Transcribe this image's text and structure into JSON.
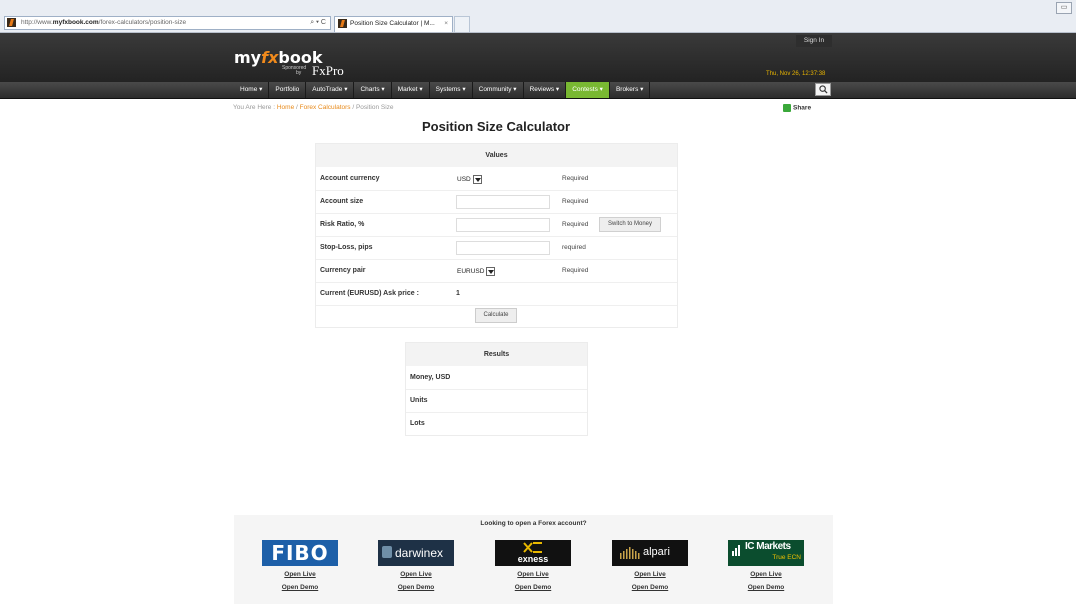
{
  "browser": {
    "url_prefix": "http://www.",
    "url_domain": "myfxbook.com",
    "url_path": "/forex-calculators/position-size",
    "url_tools": "⌕ ▾ C",
    "tab_title": "Position Size Calculator | M...",
    "tab_close": "×",
    "window_btn": "▭"
  },
  "header": {
    "logo_my": "my",
    "logo_fx": "fx",
    "logo_book": "book",
    "sponsor_line1": "Sponsored",
    "sponsor_line2": "by",
    "sponsor_name": "FxPro",
    "signin": "Sign In",
    "datetime": "Thu, Nov 26, 12:37:38"
  },
  "nav": {
    "items": [
      "Home ▾",
      "Portfolio",
      "AutoTrade ▾",
      "Charts ▾",
      "Market ▾",
      "Systems ▾",
      "Community ▾",
      "Reviews ▾",
      "Contests ▾",
      "Brokers ▾"
    ],
    "active_index": 8,
    "active_color": "#79b832"
  },
  "breadcrumb": {
    "prefix": "You Are Here : ",
    "home": "Home",
    "sep1": " / ",
    "section": "Forex Calculators",
    "sep2": " / ",
    "current": "Position Size"
  },
  "share_label": "Share",
  "page_title": "Position Size Calculator",
  "values": {
    "header": "Values",
    "account_currency": {
      "label": "Account currency",
      "value": "USD",
      "status": "Required"
    },
    "account_size": {
      "label": "Account size",
      "value": "",
      "status": "Required"
    },
    "risk_ratio": {
      "label": "Risk Ratio, %",
      "value": "",
      "status": "Required",
      "button": "Switch to Money"
    },
    "stop_loss": {
      "label": "Stop-Loss, pips",
      "value": "",
      "status": "required"
    },
    "currency_pair": {
      "label": "Currency pair",
      "value": "EURUSD",
      "status": "Required"
    },
    "ask_price": {
      "label": "Current (EURUSD) Ask price :",
      "value": "1"
    },
    "calculate": "Calculate"
  },
  "results": {
    "header": "Results",
    "rows": [
      "Money, USD",
      "Units",
      "Lots"
    ]
  },
  "brokers": {
    "title": "Looking to open a Forex account?",
    "open_live": "Open Live",
    "open_demo": "Open Demo",
    "items": [
      {
        "name": "FIBO",
        "color": "#1d5fa8"
      },
      {
        "name": "darwinex",
        "color": "#1e3146"
      },
      {
        "name": "exness",
        "color": "#111111"
      },
      {
        "name": "alpari",
        "color": "#111111"
      },
      {
        "name": "IC Markets",
        "sub": "True ECN",
        "color": "#0b4d2e"
      }
    ]
  }
}
